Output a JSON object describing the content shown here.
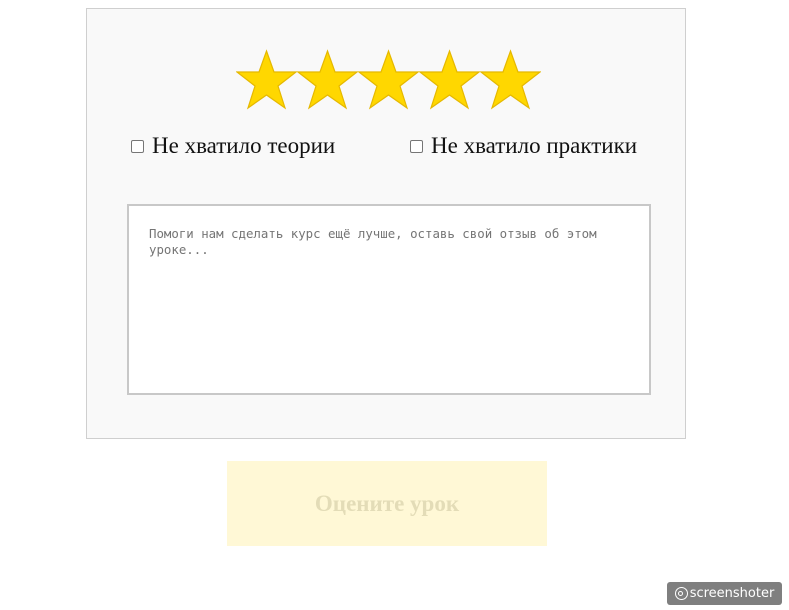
{
  "rating": {
    "value": 5,
    "max": 5,
    "star_color": "#FFD700",
    "star_border_color": "#E5B800",
    "stars": [
      {
        "index": 1,
        "filled": true
      },
      {
        "index": 2,
        "filled": true
      },
      {
        "index": 3,
        "filled": true
      },
      {
        "index": 4,
        "filled": true
      },
      {
        "index": 5,
        "filled": true
      }
    ]
  },
  "checkboxes": {
    "theory": {
      "label": "Не хватило теории",
      "checked": false
    },
    "practice": {
      "label": "Не хватило практики",
      "checked": false
    }
  },
  "feedback": {
    "placeholder": "Помоги нам сделать курс ещё лучше, оставь свой отзыв об этом уроке...",
    "value": ""
  },
  "submit": {
    "label": "Оцените урок",
    "background_color": "#FFF8D6",
    "text_color": "#E3DCB7",
    "disabled": true
  },
  "watermark": {
    "icon": "at-icon",
    "text": "screenshoter"
  }
}
